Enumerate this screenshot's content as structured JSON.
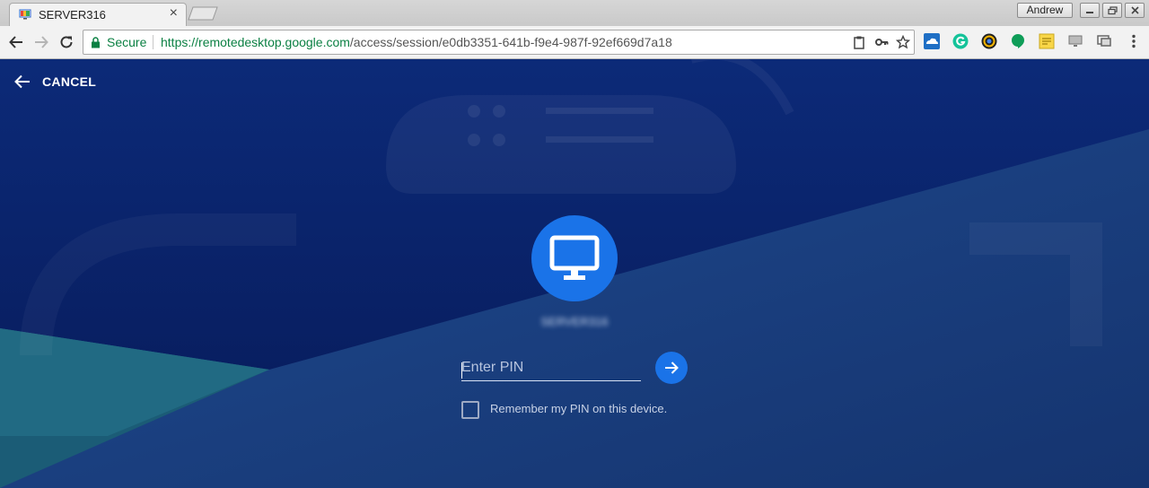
{
  "window": {
    "tab_title": "SERVER316",
    "tab_close": "×",
    "profile_name": "Andrew"
  },
  "omnibox": {
    "secure_label": "Secure",
    "url_scheme": "https://",
    "url_host": "remotedesktop.google.com",
    "url_path": "/access/session/e0db3351-641b-f9e4-987f-92ef669d7a18"
  },
  "session": {
    "cancel_label": "CANCEL",
    "host_name": "SERVER316",
    "pin_placeholder": "Enter PIN",
    "pin_value": "",
    "remember_label": "Remember my PIN on this device.",
    "remember_checked": false
  },
  "colors": {
    "accent": "#1a73e8",
    "background_dark": "#0a2160",
    "background_light": "#1e3f86",
    "background_teal": "#1a5e6e",
    "secure_green": "#0b8043"
  }
}
